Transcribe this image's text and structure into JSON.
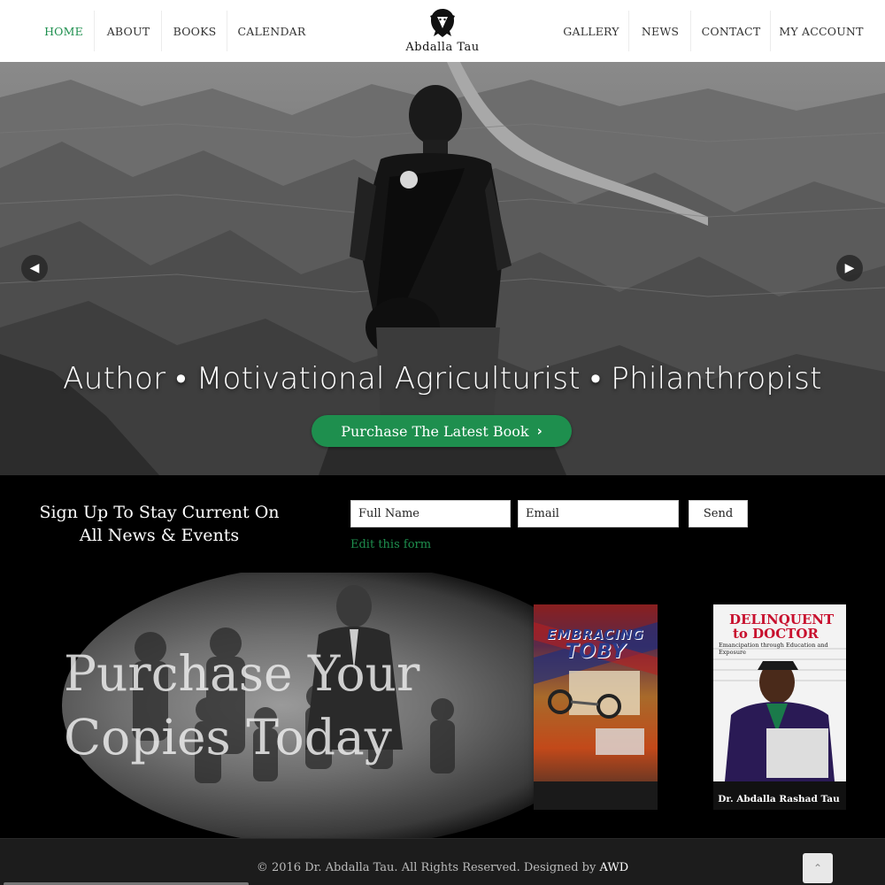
{
  "nav": {
    "left_items": [
      "HOME",
      "ABOUT",
      "BOOKS",
      "CALENDAR"
    ],
    "right_items": [
      "GALLERY",
      "NEWS",
      "CONTACT",
      "MY ACCOUNT"
    ],
    "active": "HOME",
    "logo_text": "Abdalla Tau",
    "logo_icon": "lion-head-icon"
  },
  "hero": {
    "tagline": "Author • Motivational Agriculturist •  Philanthropist",
    "cta_label": "Purchase The Latest Book",
    "cta_icon": "chevron-right-icon",
    "prev_icon": "chevron-left-icon",
    "next_icon": "chevron-right-icon"
  },
  "signup": {
    "title_line1": "Sign Up To Stay Current On",
    "title_line2": "All News & Events",
    "name_placeholder": "Full Name",
    "email_placeholder": "Email",
    "send_label": "Send",
    "edit_link": "Edit this form"
  },
  "promo": {
    "title_line1": "Purchase Your",
    "title_line2": "Copies Today",
    "book1": {
      "title_line1": "EMBRACING",
      "title_line2": "TOBY"
    },
    "book2": {
      "title_line1": "DELINQUENT",
      "title_line2": "to DOCTOR",
      "subtitle": "Emancipation through Education and Exposure",
      "author": "Dr. Abdalla Rashad Tau"
    }
  },
  "footer": {
    "copyright": "© 2016 Dr. Abdalla Tau. All Rights Reserved. Designed by",
    "designer": "AWD",
    "to_top_icon": "chevron-up-icon"
  },
  "colors": {
    "accent": "#1e8f4e",
    "nav_bg": "#ffffff",
    "page_bg": "#000000",
    "footer_bg": "#1c1c1c"
  }
}
